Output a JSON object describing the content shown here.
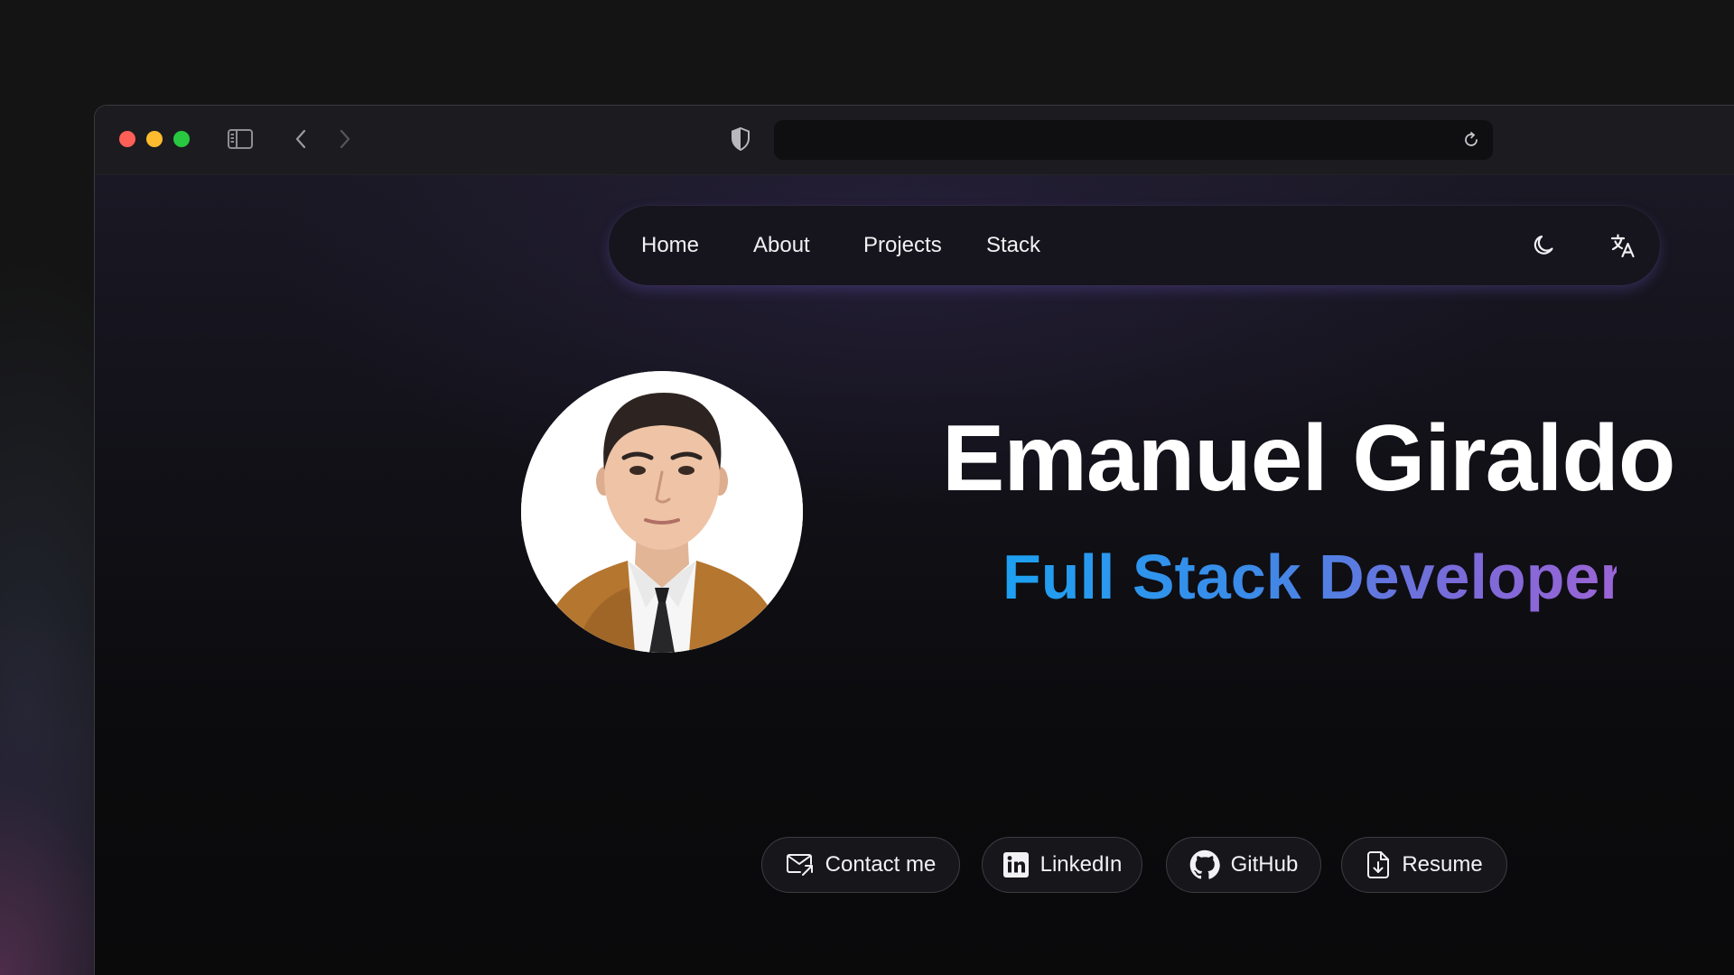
{
  "nav": {
    "items": [
      {
        "label": "Home"
      },
      {
        "label": "About"
      },
      {
        "label": "Projects"
      },
      {
        "label": "Stack"
      }
    ],
    "icons": [
      "moon-icon",
      "translate-icon"
    ]
  },
  "hero": {
    "name": "Emanuel Giraldo",
    "role": "Full Stack Developer"
  },
  "actions": [
    {
      "label": "Contact me",
      "icon": "mail-icon"
    },
    {
      "label": "LinkedIn",
      "icon": "linkedin-icon"
    },
    {
      "label": "GitHub",
      "icon": "github-icon"
    },
    {
      "label": "Resume",
      "icon": "document-download-icon"
    }
  ],
  "colors": {
    "accent_start": "#1da1f2",
    "accent_end": "#9a65d6",
    "traffic_red": "#fe5f57",
    "traffic_yellow": "#febc2e",
    "traffic_green": "#28c840"
  }
}
